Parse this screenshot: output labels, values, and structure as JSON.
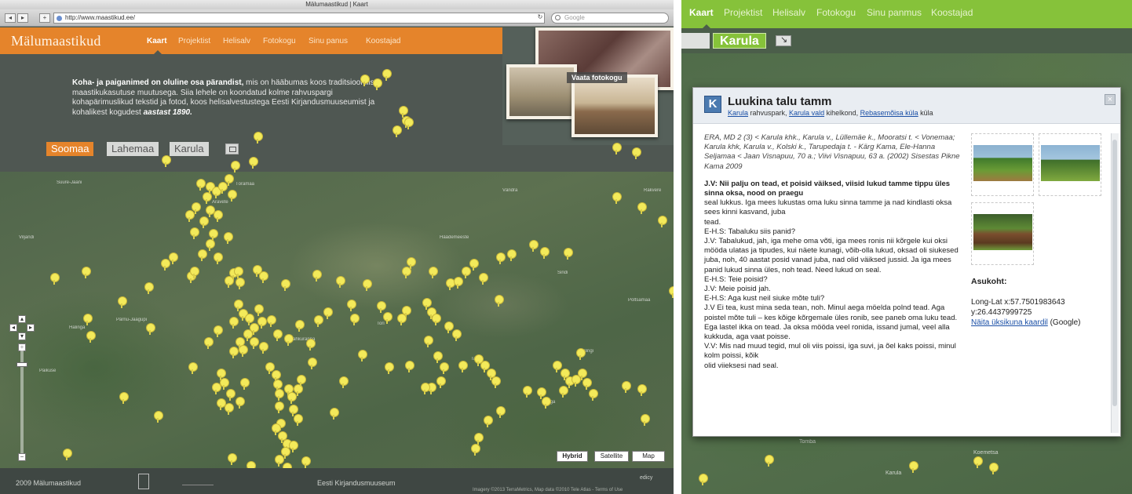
{
  "browser": {
    "window_title": "Mälumaastikud | Kaart",
    "url": "http://www.maastikud.ee/",
    "search_placeholder": "Google",
    "back": "◂",
    "forward": "▸",
    "add": "+",
    "reload": "↻"
  },
  "site": {
    "logo": "Mälumaastikud",
    "nav": [
      "Kaart",
      "Projektist",
      "Helisalv",
      "Fotokogu",
      "Sinu panus",
      "Koostajad"
    ],
    "intro": {
      "bold": "Koha- ja paiganimed on oluline osa pärandist,",
      "text": " mis on hääbumas koos traditsioonilise maastikukasutuse muutusega. Siia lehele on koondatud kolme rahvuspargi kohapärimuslikud tekstid ja fotod, koos helisalvestustega Eesti Kirjandusmuuseumist ja kohalikest kogudest ",
      "year": "aastast 1890."
    },
    "regions": [
      "Soomaa",
      "Lahemaa",
      "Karula"
    ],
    "fotokogu_label": "Vaata fotokogu",
    "map_types": [
      "Hybrid",
      "Satellite",
      "Map"
    ],
    "zoom": {
      "plus": "+",
      "minus": "−"
    },
    "places": [
      "Suure-Jaani",
      "Viljandi",
      "Tõramaa",
      "Vändra",
      "Pärnu-Jaagupi",
      "Halinga",
      "Tori",
      "Sindi",
      "Paikuse",
      "Tahkuranna",
      "Häädemeeste",
      "Kilingi",
      "Sauga",
      "Rakvere",
      "Põltsamaa",
      "Aravete",
      "Tapa"
    ],
    "footer": {
      "copyright": "2009 Mälumaastikud",
      "partner": "Eesti Kirjandusmuuseum",
      "edicy": "edicy",
      "imagery": "Imagery ©2013 TerraMetrics, Map data ©2010 Tele Atlas - Terms of Use"
    }
  },
  "right": {
    "nav": [
      "Kaart",
      "Projektist",
      "Helisalv",
      "Fotokogu",
      "Sinu panmus",
      "Koostajad"
    ],
    "active_region": "Karula",
    "popup": {
      "icon_letter": "K",
      "title": "Luukina talu tamm",
      "sub_link1": "Karula",
      "sub_text1": " rahvuspark, ",
      "sub_link2": "Karula vald",
      "sub_text2": " kihelkond, ",
      "sub_link3": "Rebasemõisa küla",
      "sub_text3": " küla",
      "citation": "ERA, MD 2 (3) < Karula khk., Karula v., Lüllemäe k., Mooratsi t. < Vonemaa; Karula khk, Karula v., Kolski k., Tarupedaja t. - Kärg Kama, Ele-Hanna Seljamaa < Jaan Visnapuu, 70 a.; Viivi Visnapuu, 63 a. (2002) Sisestas Pikne Kama 2009",
      "question": "J.V: Nii palju on tead, et poisid väiksed, viisid lukud tamme tippu üles sinna oksa, nood on praegu",
      "lines": [
        "seal lukkus. Iga mees lukustas oma luku sinna tamme ja nad kindlasti oksa sees kinni kasvand, juba",
        "tead.",
        "E-H.S: Tabaluku siis panid?",
        "J.V: Tabalukud, jah, iga mehe oma võti, iga mees ronis nii kõrgele kui oksi mööda ulatas ja tipudes, kui näete kunagi, võib-olla lukud, oksad oli siukesed juba, noh, 40 aastat posid vanad juba, nad olid väiksed jussid. Ja iga mees panid lukud sinna üles, noh tead. Need lukud on seal.",
        "E-H.S: Teie poisid?",
        "J.V: Meie poisid jah.",
        "E-H.S: Aga kust neil siuke mõte tuli?",
        "J.V Ei tea, kust mina seda tean, noh. Minul aega möelda polnd tead. Aga poistel mõte tuli – kes kõige kõrgemale üles ronib, see paneb oma luku tead. Ega lastel ikka on tead. Ja oksa mööda veel ronida, issand jumal, veel alla kukkuda, aga vaat poisse.",
        "V.V: Mis nad muud tegid, mul oli viis poissi, iga suvi, ja õel kaks poissi, minul kolm poissi, kõik",
        "olid viieksesi nad seal."
      ],
      "asukoht_title": "Asukoht:",
      "coords_1": "Long-Lat x:57.7501983643",
      "coords_2": "y:26.4437999725",
      "map_link": "Näita üksikuna kaardil",
      "map_link_suffix": " (Google)",
      "close": "×"
    },
    "places": [
      "Koemetsa",
      "Tomba",
      "Karula"
    ]
  },
  "colors": {
    "orange": "#e5842b",
    "green": "#86c23a",
    "pin": "#f3ea5a",
    "link": "#1a4fa6"
  }
}
